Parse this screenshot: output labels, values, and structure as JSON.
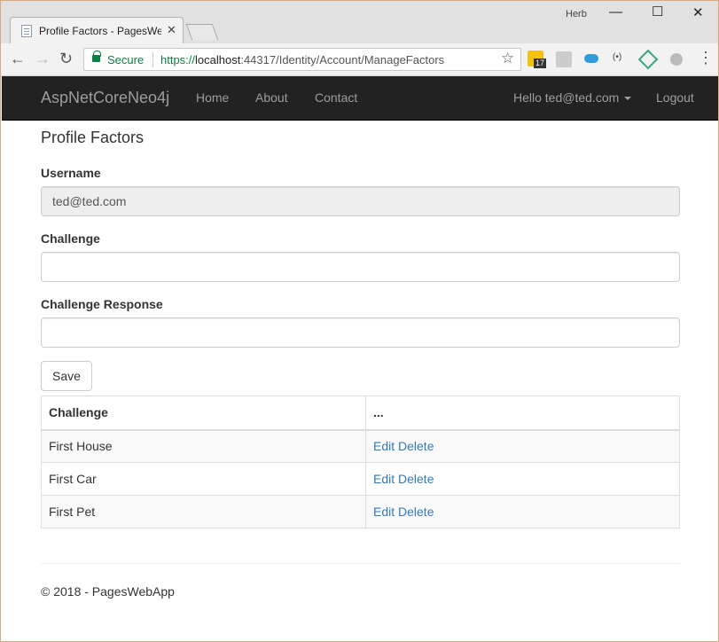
{
  "browser": {
    "tab_title": "Profile Factors - PagesWe",
    "user": "Herb",
    "secure_label": "Secure",
    "url_scheme": "https://",
    "url_host": "localhost",
    "url_rest": ":44317/Identity/Account/ManageFactors",
    "extension_badge": "17"
  },
  "navbar": {
    "brand": "AspNetCoreNeo4j",
    "links": [
      "Home",
      "About",
      "Contact"
    ],
    "greeting": "Hello ted@ted.com",
    "logout": "Logout"
  },
  "page": {
    "title": "Profile Factors",
    "username_label": "Username",
    "username_value": "ted@ted.com",
    "challenge_label": "Challenge",
    "challenge_value": "",
    "response_label": "Challenge Response",
    "response_value": "",
    "save_label": "Save"
  },
  "table": {
    "headers": [
      "Challenge",
      "..."
    ],
    "rows": [
      {
        "challenge": "First House",
        "edit": "Edit",
        "delete": "Delete"
      },
      {
        "challenge": "First Car",
        "edit": "Edit",
        "delete": "Delete"
      },
      {
        "challenge": "First Pet",
        "edit": "Edit",
        "delete": "Delete"
      }
    ]
  },
  "footer": {
    "text": "© 2018 - PagesWebApp"
  },
  "colors": {
    "navbar_bg": "#222222",
    "link": "#337ab7",
    "secure_green": "#0b8043"
  }
}
